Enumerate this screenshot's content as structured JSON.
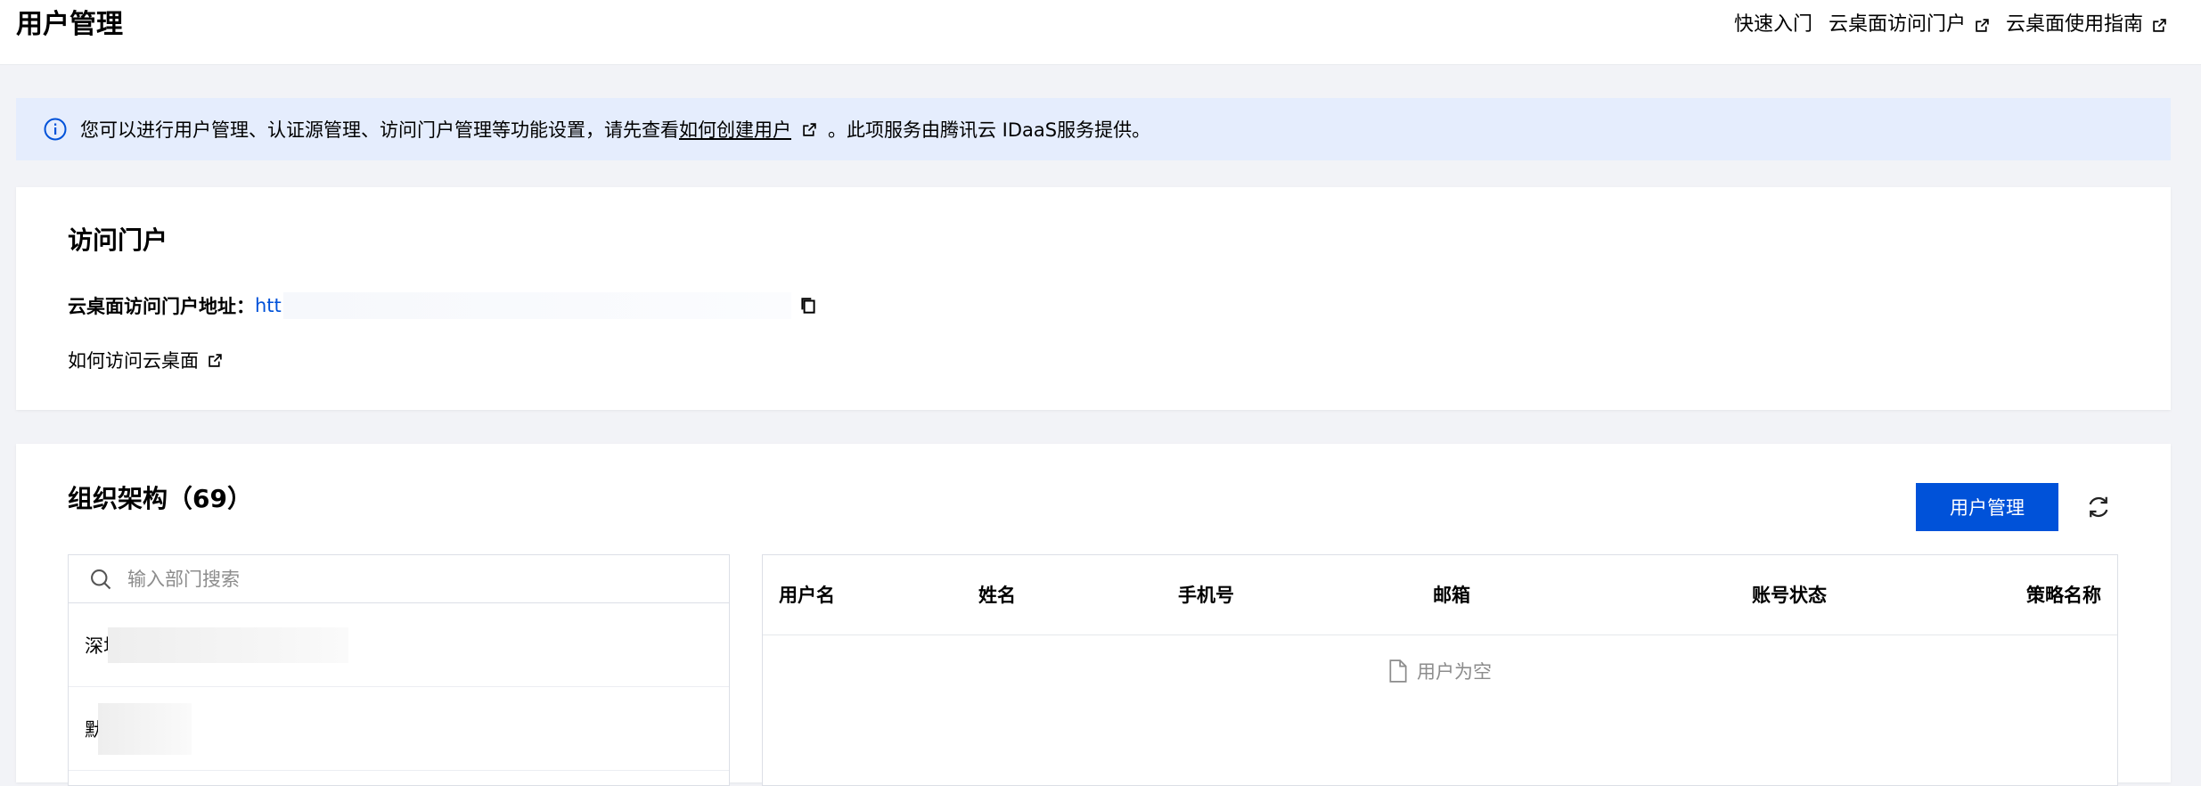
{
  "header": {
    "title": "用户管理",
    "links": {
      "quick_start": "快速入门",
      "portal": "云桌面访问门户",
      "guide": "云桌面使用指南"
    }
  },
  "notice": {
    "text_before": "您可以进行用户管理、认证源管理、访问门户管理等功能设置，请先查看",
    "link": "如何创建用户",
    "text_after": "。此项服务由腾讯云 IDaaS服务提供。"
  },
  "portal": {
    "title": "访问门户",
    "address_label": "云桌面访问门户地址：",
    "address_url": "htt",
    "how_to_access": "如何访问云桌面"
  },
  "org": {
    "title": "组织架构（69）",
    "manage_button": "用户管理",
    "search_placeholder": "输入部门搜索",
    "departments": [
      {
        "label": "深圳"
      },
      {
        "label": "默"
      }
    ],
    "table": {
      "columns": [
        "用户名",
        "姓名",
        "手机号",
        "邮箱",
        "账号状态",
        "策略名称"
      ],
      "empty_text": "用户为空"
    }
  },
  "colors": {
    "primary": "#0052d9",
    "notice_bg": "#e5edfd",
    "page_bg": "#f2f3f7"
  }
}
